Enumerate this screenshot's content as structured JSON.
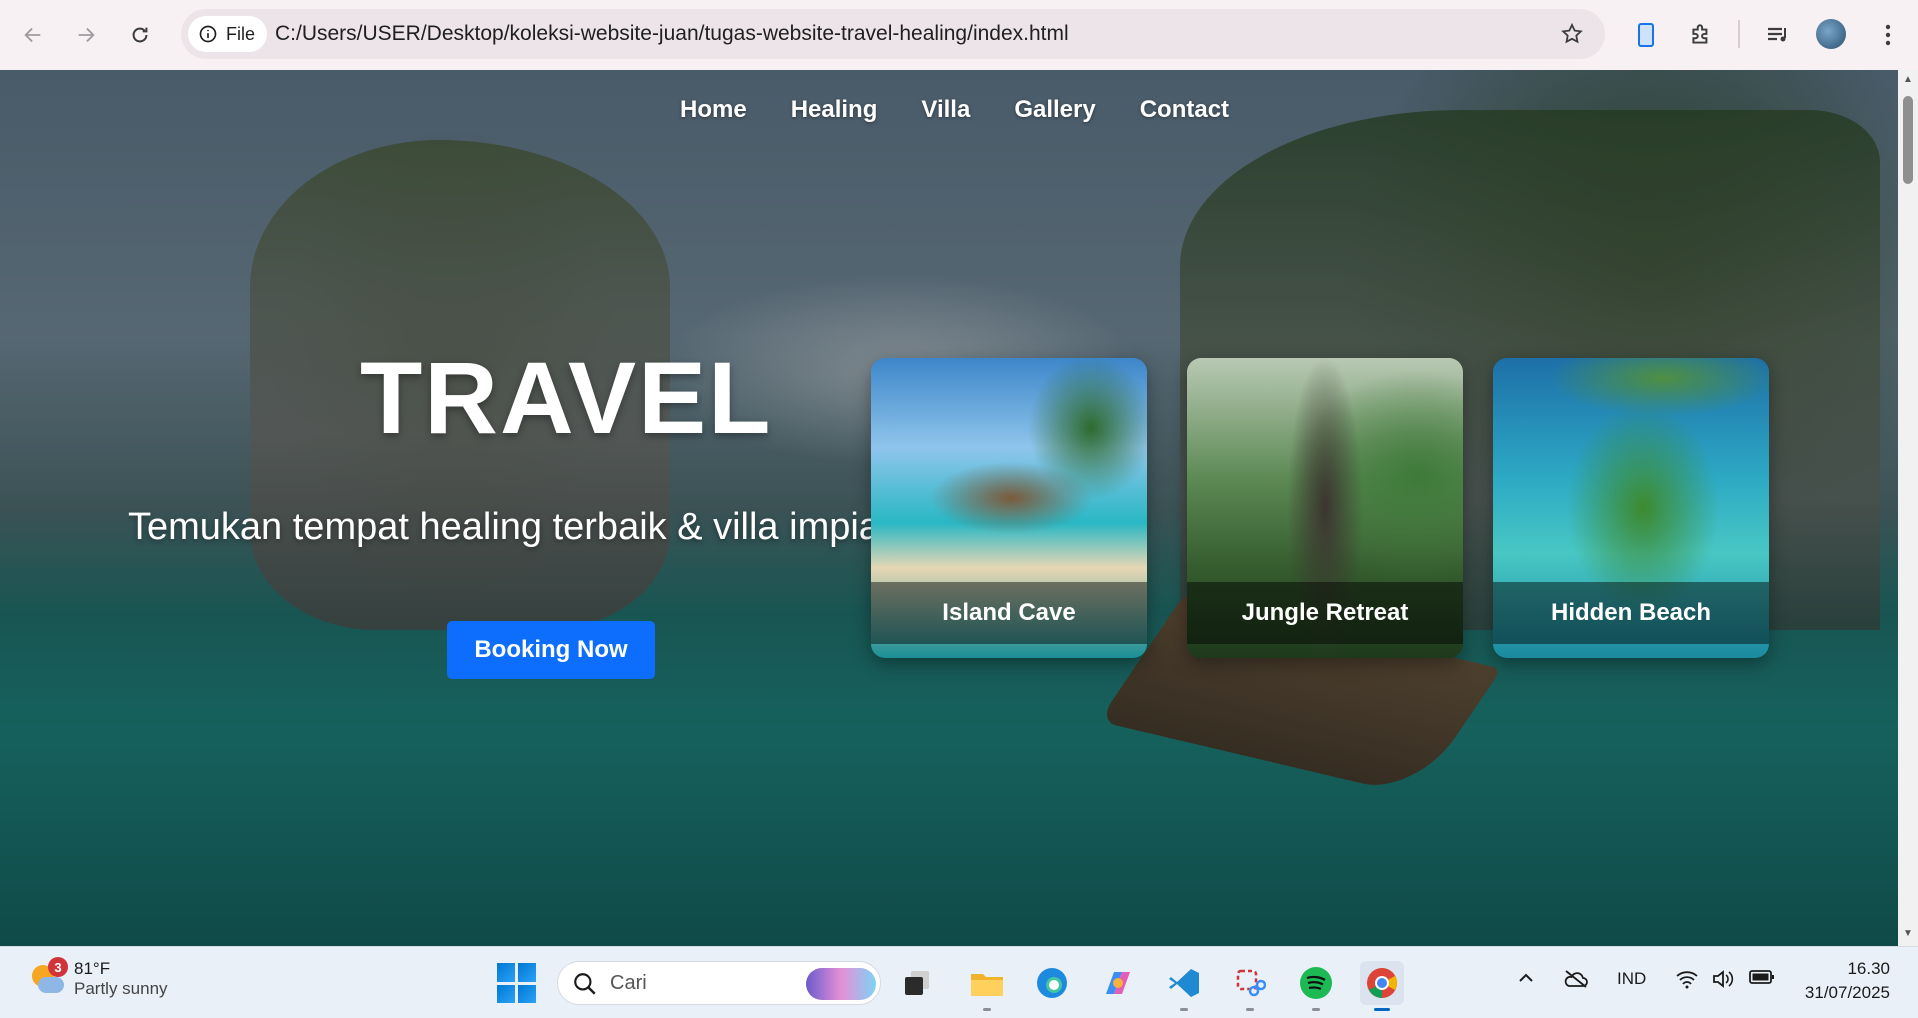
{
  "browser": {
    "file_label": "File",
    "url": "C:/Users/USER/Desktop/koleksi-website-juan/tugas-website-travel-healing/index.html"
  },
  "site": {
    "nav": [
      "Home",
      "Healing",
      "Villa",
      "Gallery",
      "Contact"
    ],
    "hero_title": "TRAVEL",
    "hero_subtitle": "Temukan tempat healing terbaik & villa impian",
    "booking_label": "Booking Now",
    "cards": [
      {
        "label": "Island Cave"
      },
      {
        "label": "Jungle Retreat"
      },
      {
        "label": "Hidden Beach"
      }
    ]
  },
  "taskbar": {
    "weather_badge": "3",
    "weather_temp": "81°F",
    "weather_desc": "Partly sunny",
    "search_placeholder": "Cari",
    "language": "IND",
    "time": "16.30",
    "date": "31/07/2025"
  },
  "colors": {
    "accent": "#0d6efd",
    "browser_bar": "#f7f1f3",
    "taskbar": "#eaf0f8"
  }
}
